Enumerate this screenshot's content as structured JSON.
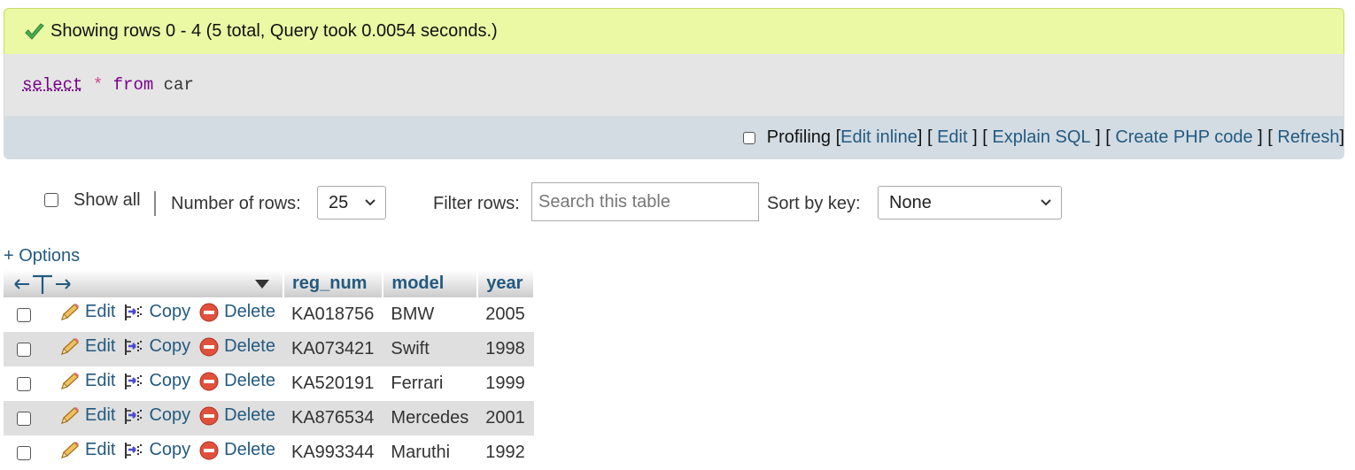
{
  "status": {
    "message": "Showing rows 0 - 4 (5 total, Query took 0.0054 seconds.)",
    "color": "#ebf8a4"
  },
  "query": {
    "keyword_select": "select",
    "star": "*",
    "keyword_from": "from",
    "table": "car"
  },
  "toolbar": {
    "profiling_label": "Profiling",
    "edit_inline": "Edit inline",
    "edit": "Edit",
    "explain_sql": "Explain SQL",
    "create_php": "Create PHP code",
    "refresh": "Refresh"
  },
  "nav": {
    "show_all_label": "Show all",
    "rows_label": "Number of rows:",
    "rows_value": "25",
    "filter_label": "Filter rows:",
    "search_placeholder": "Search this table",
    "sort_label": "Sort by key:",
    "sort_value": "None"
  },
  "options_link": "+ Options",
  "table": {
    "columns": [
      "reg_num",
      "model",
      "year"
    ],
    "actions": {
      "edit": "Edit",
      "copy": "Copy",
      "delete": "Delete"
    },
    "rows": [
      {
        "reg_num": "KA018756",
        "model": "BMW",
        "year": "2005"
      },
      {
        "reg_num": "KA073421",
        "model": "Swift",
        "year": "1998"
      },
      {
        "reg_num": "KA520191",
        "model": "Ferrari",
        "year": "1999"
      },
      {
        "reg_num": "KA876534",
        "model": "Mercedes",
        "year": "2001"
      },
      {
        "reg_num": "KA993344",
        "model": "Maruthi",
        "year": "1992"
      }
    ]
  },
  "colors": {
    "link": "#235a81",
    "toolbar_bg": "#d3dce3",
    "sql_bg": "#e5e5e5",
    "row_alt_bg": "#dfdfdf"
  }
}
